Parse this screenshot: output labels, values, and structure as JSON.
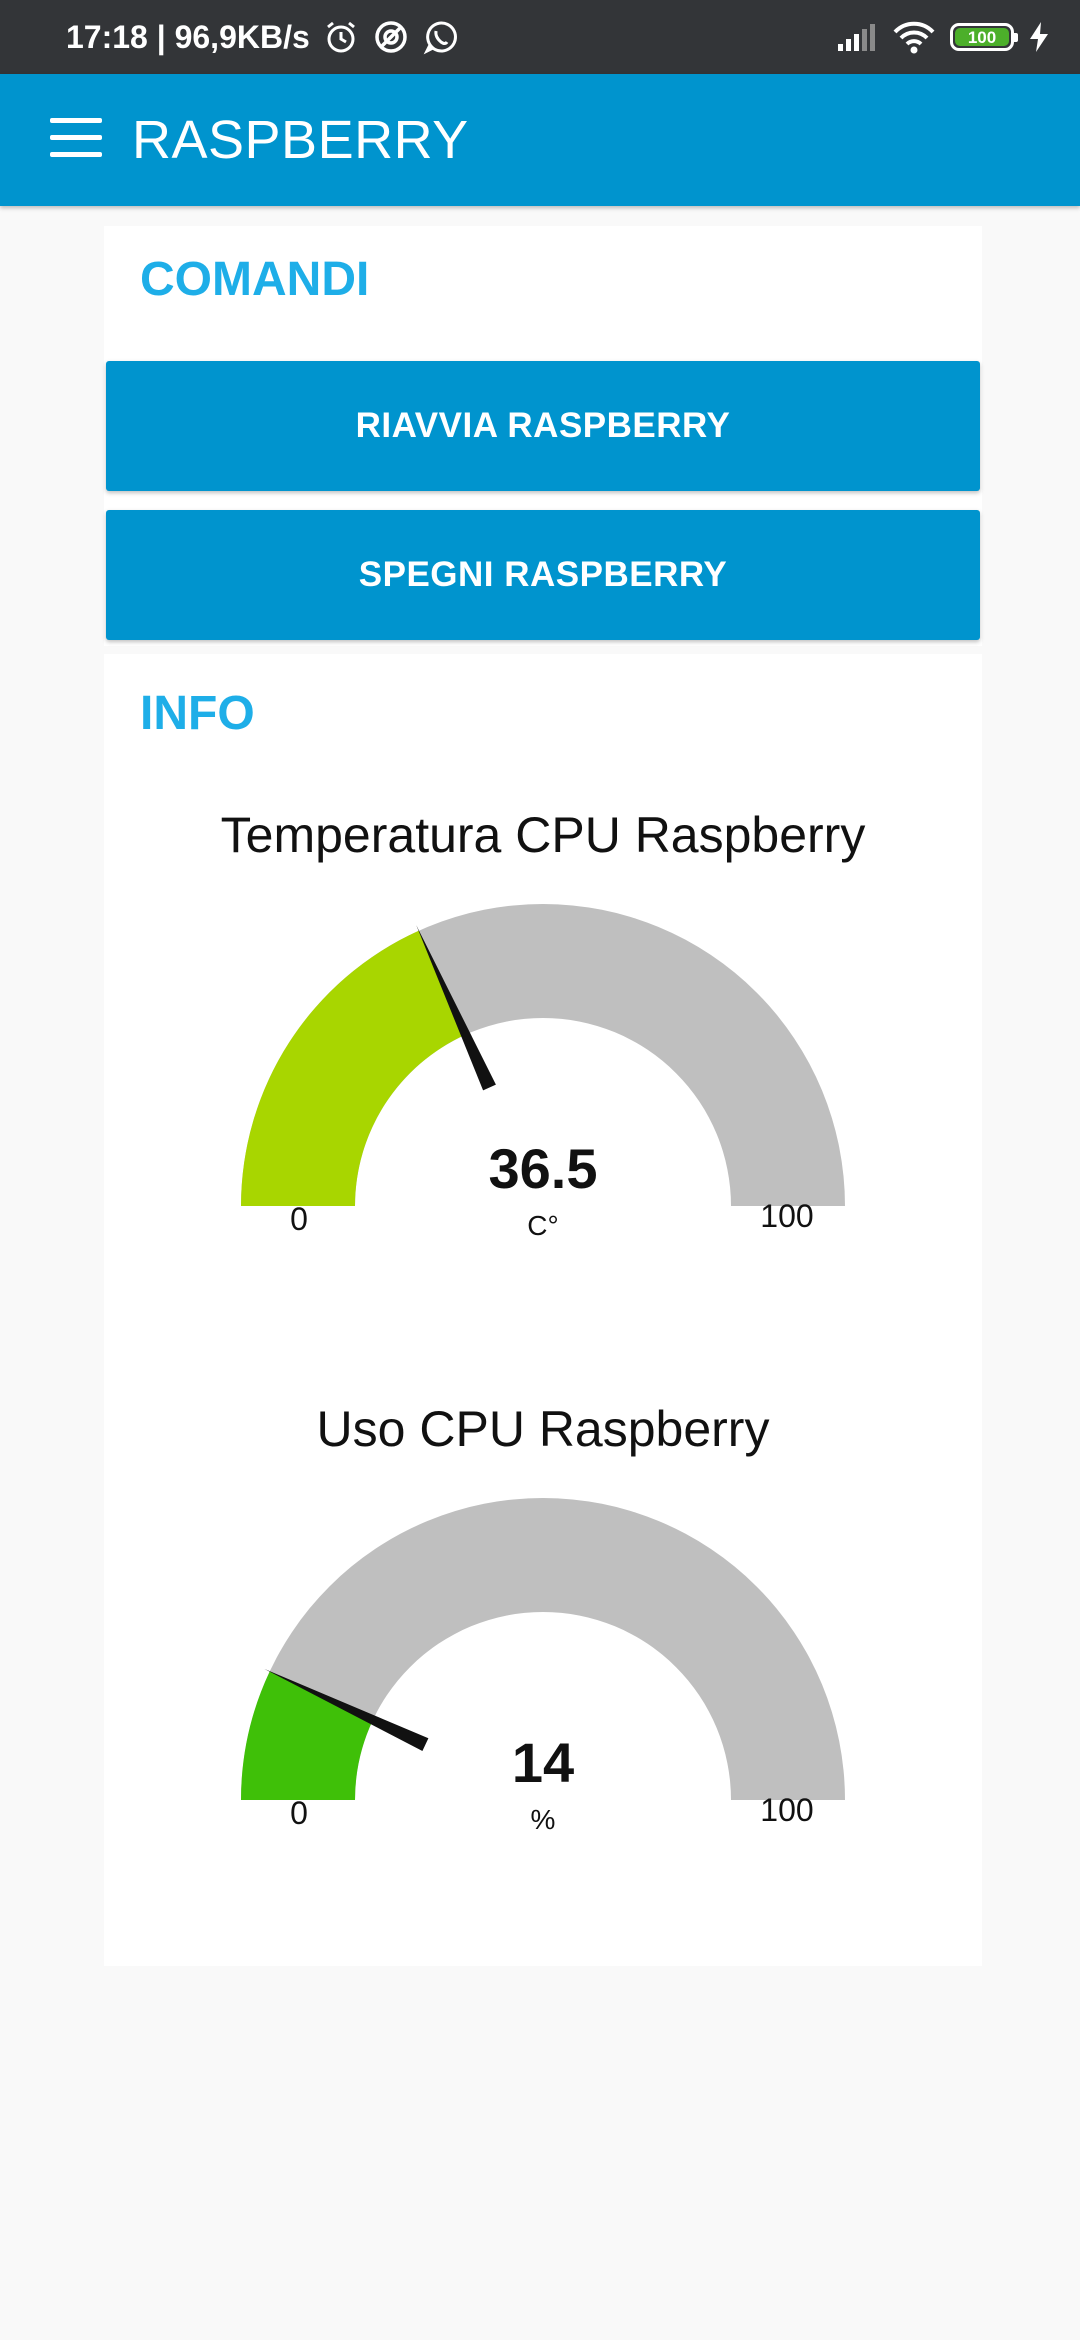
{
  "status_bar": {
    "time_speed": "17:18 | 96,9KB/s",
    "battery_level": "100",
    "icons": [
      "alarm-icon",
      "no-disturb-icon",
      "whatsapp-icon",
      "signal-icon",
      "wifi-icon",
      "battery-icon",
      "charging-icon"
    ]
  },
  "app_bar": {
    "title": "RASPBERRY",
    "menu_icon": "menu-icon"
  },
  "comandi": {
    "title": "COMANDI",
    "buttons": [
      {
        "label": "RIAVVIA RASPBERRY"
      },
      {
        "label": "SPEGNI RASPBERRY"
      }
    ]
  },
  "info": {
    "title": "INFO",
    "gauges": [
      {
        "title": "Temperatura CPU Raspberry",
        "value": 36.5,
        "value_text": "36.5",
        "unit": "C°",
        "min": 0,
        "max": 100,
        "min_label": "0",
        "max_label": "100",
        "color": "#a8d600"
      },
      {
        "title": "Uso CPU Raspberry",
        "value": 14,
        "value_text": "14",
        "unit": "%",
        "min": 0,
        "max": 100,
        "min_label": "0",
        "max_label": "100",
        "color": "#3fc008"
      }
    ]
  },
  "colors": {
    "primary": "#0094ce",
    "group_title": "#1eaee8",
    "gauge_track": "#bfbfbf",
    "needle": "#111111"
  }
}
